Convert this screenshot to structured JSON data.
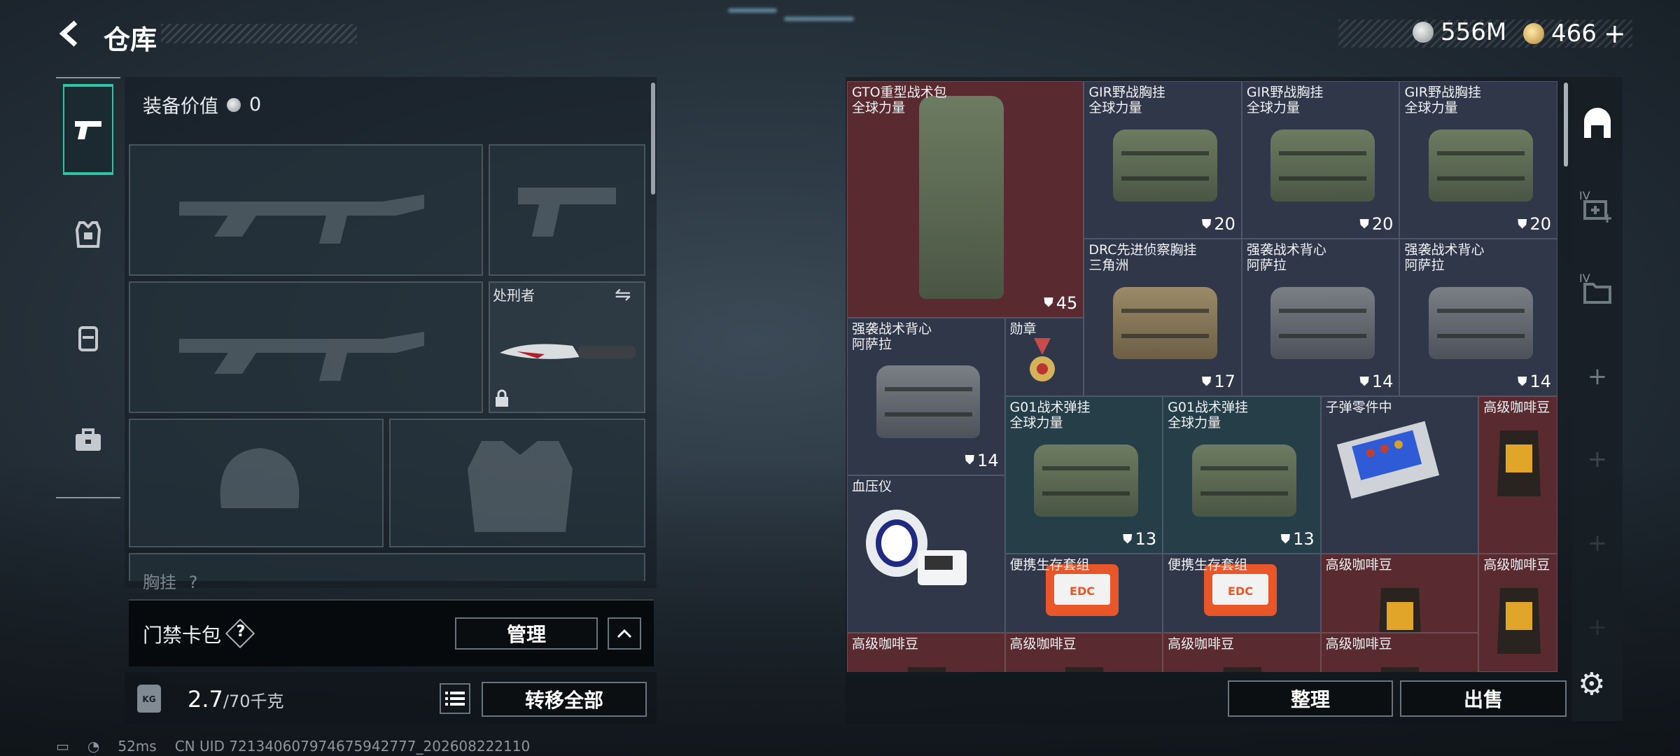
{
  "header": {
    "title": "仓库",
    "currency_silver": "556M",
    "currency_gold": "466",
    "gold_plus": "+"
  },
  "equipment": {
    "value_label": "装备价值",
    "value": "0",
    "knife_name": "处刑者",
    "vest_label": "胸挂",
    "vest_hint": "?"
  },
  "card_pack": {
    "label": "门禁卡包",
    "help": "?",
    "manage_button": "管理"
  },
  "weight": {
    "current": "2.7",
    "max": "/70千克",
    "kg_tag": "KG",
    "transfer_all": "转移全部"
  },
  "warehouse": {
    "items": [
      {
        "name": "GTO重型战术包\n全球力量",
        "qty": "45",
        "color": "red"
      },
      {
        "name": "GIR野战胸挂\n全球力量",
        "qty": "20",
        "color": "blue"
      },
      {
        "name": "GIR野战胸挂\n全球力量",
        "qty": "20",
        "color": "blue"
      },
      {
        "name": "GIR野战胸挂\n全球力量",
        "qty": "20",
        "color": "blue"
      },
      {
        "name": "DRC先进侦察胸挂\n三角洲",
        "qty": "17",
        "color": "blue"
      },
      {
        "name": "强袭战术背心\n阿萨拉",
        "qty": "14",
        "color": "blue"
      },
      {
        "name": "强袭战术背心\n阿萨拉",
        "qty": "14",
        "color": "blue"
      },
      {
        "name": "强袭战术背心\n阿萨拉",
        "qty": "14",
        "color": "blue"
      },
      {
        "name": "勋章",
        "qty": "",
        "color": "blue"
      },
      {
        "name": "G01战术弹挂\n全球力量",
        "qty": "13",
        "color": "teal"
      },
      {
        "name": "G01战术弹挂\n全球力量",
        "qty": "13",
        "color": "teal"
      },
      {
        "name": "子弹零件中",
        "qty": "",
        "color": "blue"
      },
      {
        "name": "高级咖啡豆",
        "qty": "",
        "color": "red"
      },
      {
        "name": "血压仪",
        "qty": "",
        "color": "blue"
      },
      {
        "name": "便携生存套组",
        "qty": "",
        "color": "blue"
      },
      {
        "name": "便携生存套组",
        "qty": "",
        "color": "blue"
      },
      {
        "name": "高级咖啡豆",
        "qty": "",
        "color": "red"
      },
      {
        "name": "高级咖啡豆",
        "qty": "",
        "color": "red"
      },
      {
        "name": "高级咖啡豆",
        "qty": "",
        "color": "red"
      },
      {
        "name": "高级咖啡豆",
        "qty": "",
        "color": "red"
      },
      {
        "name": "高级咖啡豆",
        "qty": "",
        "color": "red"
      },
      {
        "name": "高级咖啡豆",
        "qty": "",
        "color": "red"
      }
    ],
    "sort_button": "整理",
    "sell_button": "出售"
  },
  "side_tabs": {
    "tab2_roman": "IV",
    "tab3_roman": "IV"
  },
  "status_bar": {
    "ping": "52ms",
    "uid": "CN UID 721340607974675942777_202608222110"
  },
  "colors": {
    "accent": "#2ec4a6",
    "cell_red": "#5a2a31",
    "cell_blue": "#2f3748",
    "cell_teal": "#253e48"
  }
}
